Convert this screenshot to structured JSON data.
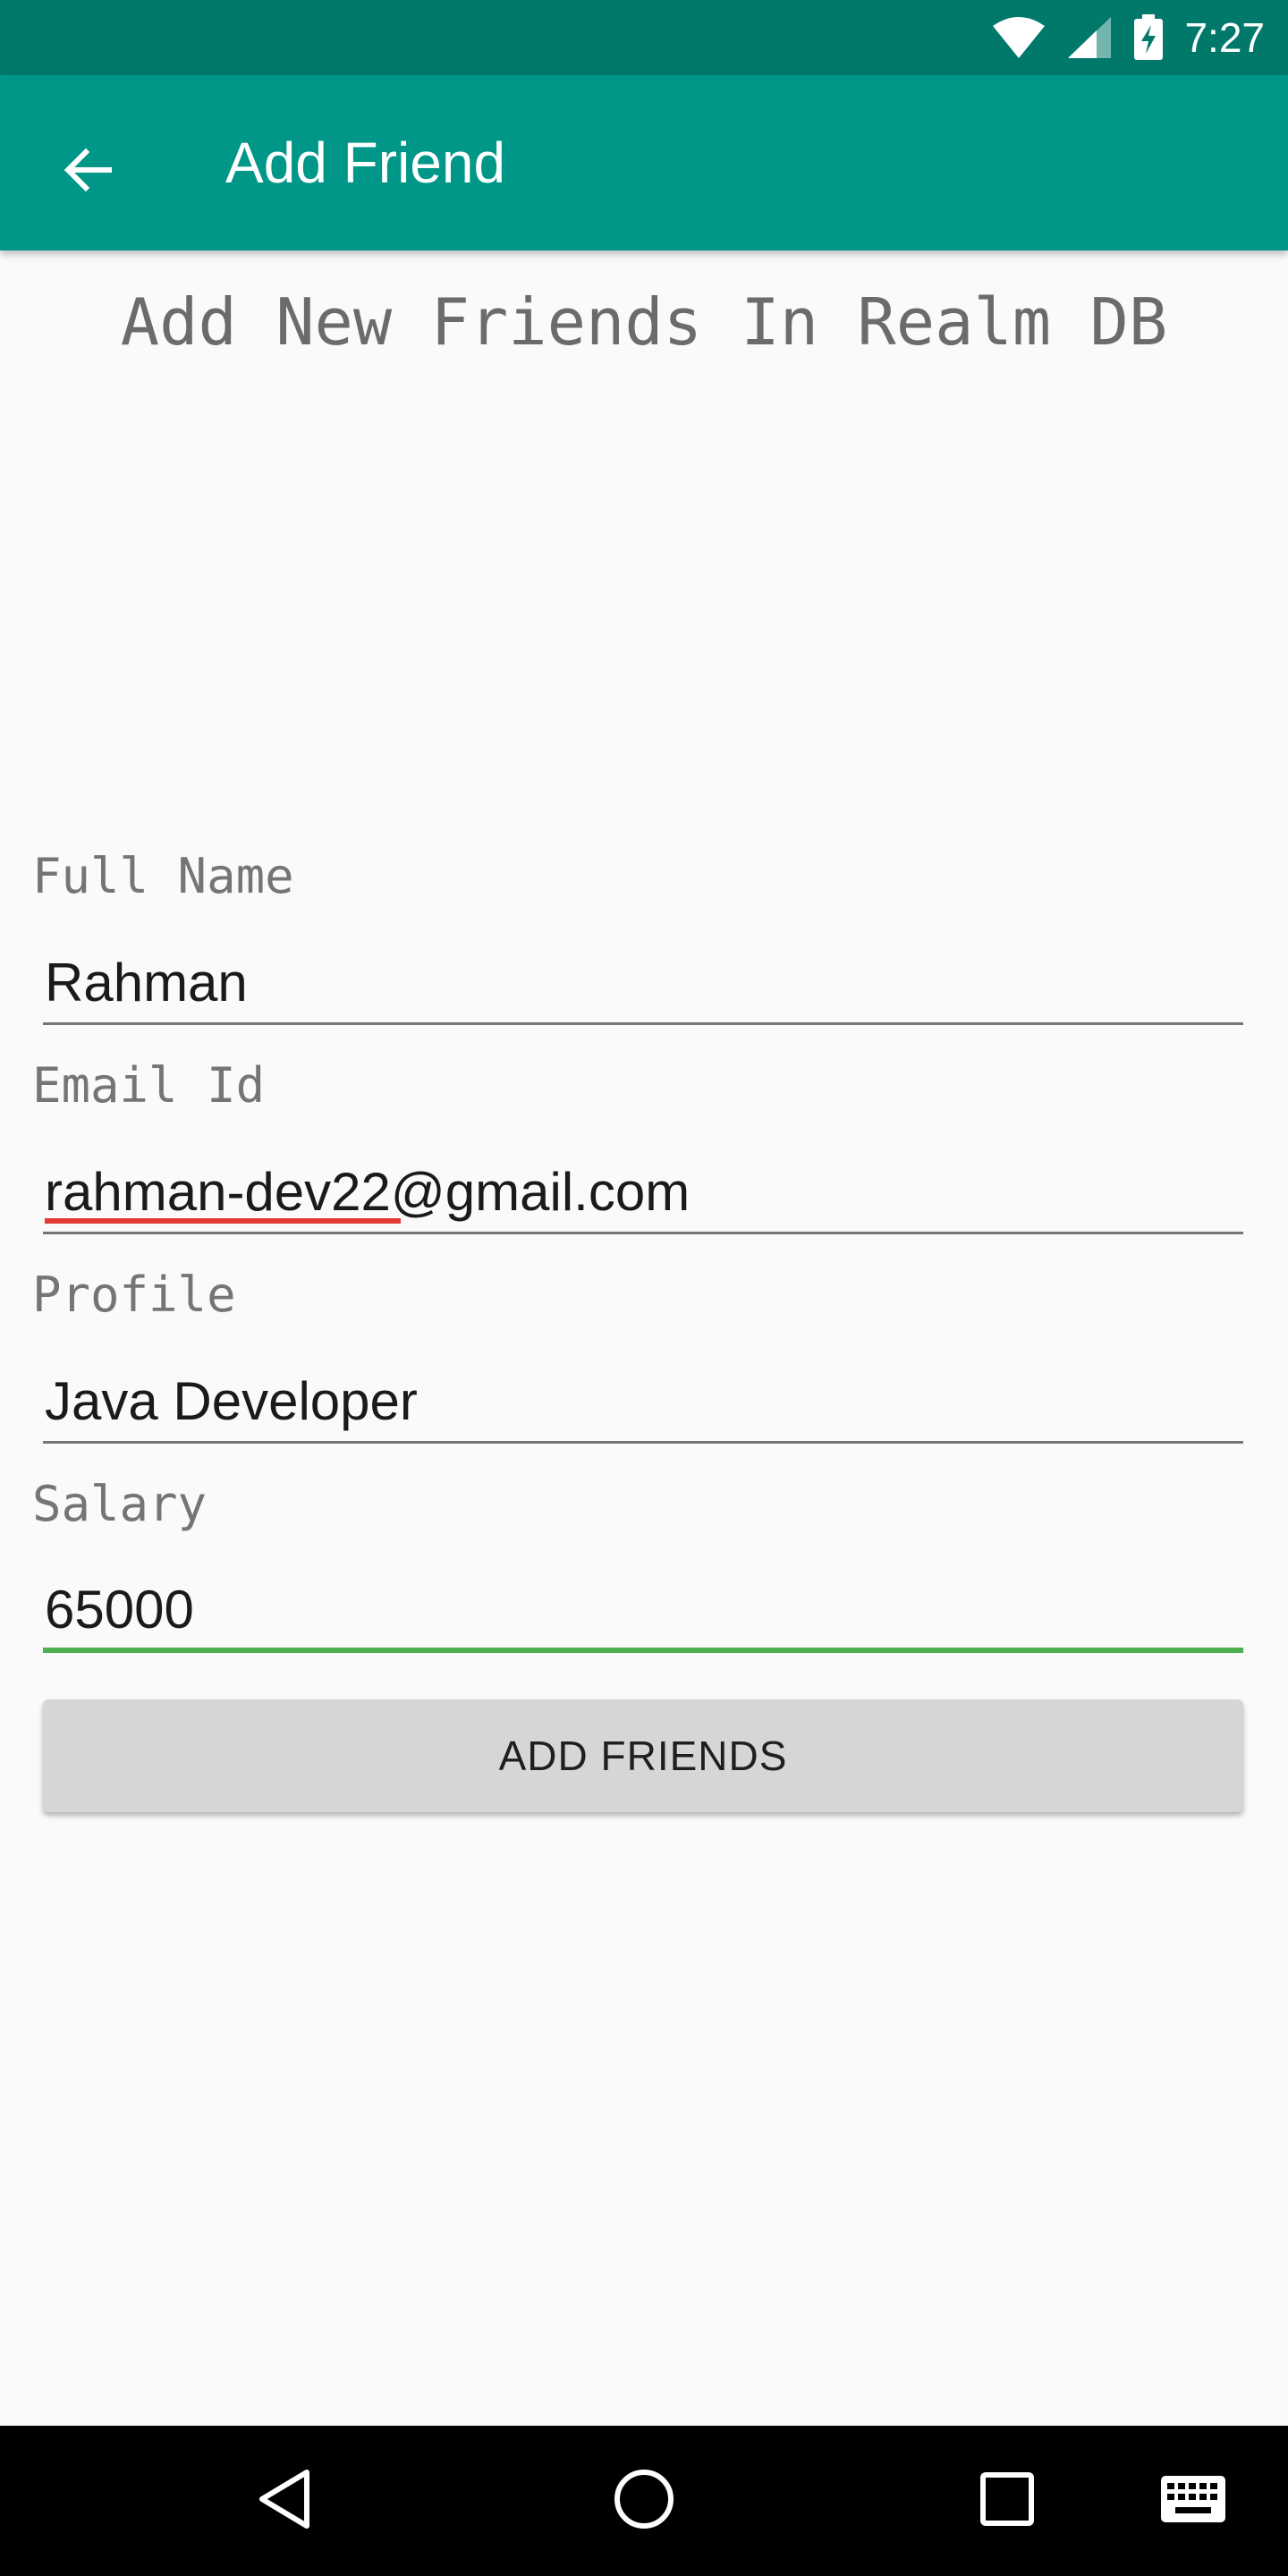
{
  "status_bar": {
    "time": "7:27",
    "icons": [
      "wifi-icon",
      "cell-signal-icon",
      "battery-charging-icon"
    ]
  },
  "app_bar": {
    "title": "Add Friend",
    "back_icon": "arrow-back-icon"
  },
  "heading": "Add New Friends In Realm DB",
  "form": {
    "full_name": {
      "label": "Full Name",
      "value": "Rahman"
    },
    "email": {
      "label": "Email Id",
      "value": "rahman-dev22@gmail.com"
    },
    "profile": {
      "label": "Profile",
      "value": "Java Developer"
    },
    "salary": {
      "label": "Salary",
      "value": "65000"
    }
  },
  "add_button_label": "ADD FRIENDS",
  "colors": {
    "primary": "#009688",
    "primary_dark": "#00796b",
    "focus_accent": "#4caf50",
    "spellcheck": "#e53935"
  },
  "nav_bar": {
    "icons": [
      "back-triangle-icon",
      "home-circle-icon",
      "recents-square-icon",
      "keyboard-icon"
    ]
  }
}
